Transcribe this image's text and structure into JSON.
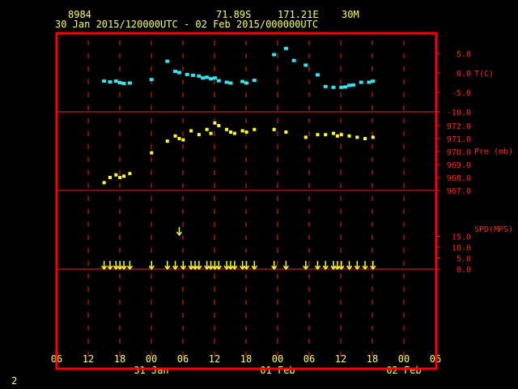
{
  "header": {
    "station_id": "8984",
    "latitude": "71.89S",
    "longitude": "171.21E",
    "elevation": "30M",
    "time_range": "30 Jan 2015/120000UTC - 02 Feb 2015/000000UTC"
  },
  "footer": {
    "page_number": "2"
  },
  "colors": {
    "frame": "#ff0000",
    "grid": "#ff2222",
    "axis_text": "#ffff55",
    "temperature": "#33e6ee",
    "pressure": "#ffff22",
    "wind": "#ffff22"
  },
  "chart_data": [
    {
      "type": "scatter",
      "panel": "temperature",
      "ylabel": "T(C)",
      "yticks": [
        "5.0",
        "0.0",
        "-5.0",
        "-10.0"
      ],
      "ylim": [
        -10,
        7.5
      ],
      "x_units": "hours since 30 Jan 2015 06 UTC",
      "series": [
        {
          "x": [
            12,
            13.5,
            15,
            16,
            17,
            18.5,
            24,
            28,
            30,
            31,
            33,
            34.5,
            36,
            37,
            38,
            39,
            40,
            41,
            43,
            44,
            47,
            48,
            50,
            55,
            58,
            60,
            63,
            66,
            68,
            70,
            72,
            73,
            74,
            75,
            77,
            79,
            80
          ],
          "y": [
            -2.1,
            -2.3,
            -2.1,
            -2.5,
            -2.7,
            -2.6,
            -1.7,
            3,
            0.4,
            0.1,
            -0.4,
            -0.6,
            -0.8,
            -1.3,
            -1.1,
            -1.5,
            -1.3,
            -2.0,
            -2.4,
            -2.6,
            -2.2,
            -2.6,
            -1.9,
            4.7,
            6.3,
            3.2,
            2.0,
            -0.5,
            -3.5,
            -3.7,
            -3.7,
            -3.6,
            -3.2,
            -3.1,
            -2.4,
            -2.4,
            -2.1
          ]
        }
      ]
    },
    {
      "type": "scatter",
      "panel": "pressure",
      "ylabel": "Pre (mb)",
      "yticks": [
        "972.0",
        "971.0",
        "970.0",
        "969.0",
        "968.0",
        "967.0"
      ],
      "ylim": [
        967,
        973
      ],
      "x_units": "hours since 30 Jan 2015 06 UTC",
      "series": [
        {
          "x": [
            12,
            13.5,
            15,
            16,
            17,
            18.5,
            24,
            28,
            30,
            31,
            32,
            34,
            36,
            38,
            39,
            40,
            41,
            43,
            44,
            45,
            47,
            48,
            50,
            55,
            58,
            63,
            66,
            68,
            70,
            71,
            72,
            74,
            76,
            78,
            80
          ],
          "y": [
            967.6,
            968.0,
            968.2,
            968.0,
            968.1,
            968.3,
            969.9,
            970.8,
            971.2,
            971.0,
            970.9,
            971.6,
            971.3,
            971.7,
            971.4,
            972.2,
            972.0,
            971.7,
            971.5,
            971.4,
            971.6,
            971.5,
            971.7,
            971.7,
            971.5,
            971.1,
            971.3,
            971.3,
            971.4,
            971.2,
            971.3,
            971.2,
            971.1,
            971.0,
            971.1
          ]
        }
      ]
    },
    {
      "type": "scatter",
      "panel": "wind",
      "ylabel": "SPD(MPS)",
      "yticks": [
        "15.0",
        "10.0",
        "5.0",
        "0.0"
      ],
      "ylim": [
        -2.5,
        20
      ],
      "x_units": "hours since 30 Jan 2015 06 UTC",
      "series": [
        {
          "x": [
            12,
            13.5,
            15,
            16,
            17,
            18.5,
            24,
            28,
            30,
            31,
            32,
            34,
            35,
            36,
            38,
            39,
            40,
            41,
            43,
            44,
            45,
            47,
            48,
            50,
            55,
            58,
            63,
            66,
            68,
            70,
            71,
            72,
            74,
            76,
            78,
            80
          ],
          "y": [
            0,
            0,
            0,
            0,
            0,
            0,
            0,
            0,
            0,
            15.5,
            0,
            0,
            0,
            0,
            0,
            0,
            0,
            0,
            0,
            0,
            0,
            0,
            0,
            0,
            0,
            0,
            0,
            0,
            0,
            0,
            0,
            0,
            0,
            0,
            0,
            0
          ]
        }
      ]
    }
  ],
  "x_axis": {
    "tick_labels": [
      "06",
      "12",
      "18",
      "00",
      "06",
      "12",
      "18",
      "00",
      "06",
      "12",
      "18",
      "00",
      "06"
    ],
    "day_labels": [
      "31 Jan",
      "01 Feb",
      "02 Feb"
    ]
  }
}
